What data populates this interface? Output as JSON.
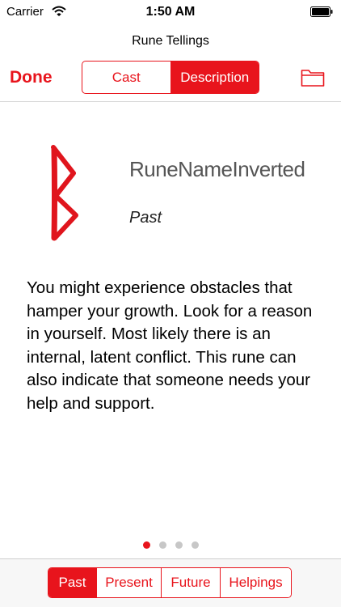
{
  "status_bar": {
    "carrier": "Carrier",
    "time": "1:50 AM"
  },
  "nav": {
    "title": "Rune Tellings",
    "done_label": "Done"
  },
  "segments": [
    {
      "label": "Cast",
      "active": false
    },
    {
      "label": "Description",
      "active": true
    }
  ],
  "rune": {
    "name": "RuneNameInverted",
    "position": "Past",
    "description": "You might experience obstacles that hamper your growth. Look for a reason in yourself. Most likely there is an internal, latent conflict. This rune can also indicate that someone needs your help and support.",
    "glyph_color": "#e0151d"
  },
  "pager": {
    "total": 4,
    "current": 1
  },
  "time_tabs": [
    {
      "label": "Past",
      "active": true
    },
    {
      "label": "Present",
      "active": false
    },
    {
      "label": "Future",
      "active": false
    },
    {
      "label": "Helpings",
      "active": false
    }
  ],
  "colors": {
    "accent": "#e8141c"
  },
  "icons": {
    "wifi": "wifi-icon",
    "battery": "battery-icon",
    "folder": "folder-icon"
  }
}
